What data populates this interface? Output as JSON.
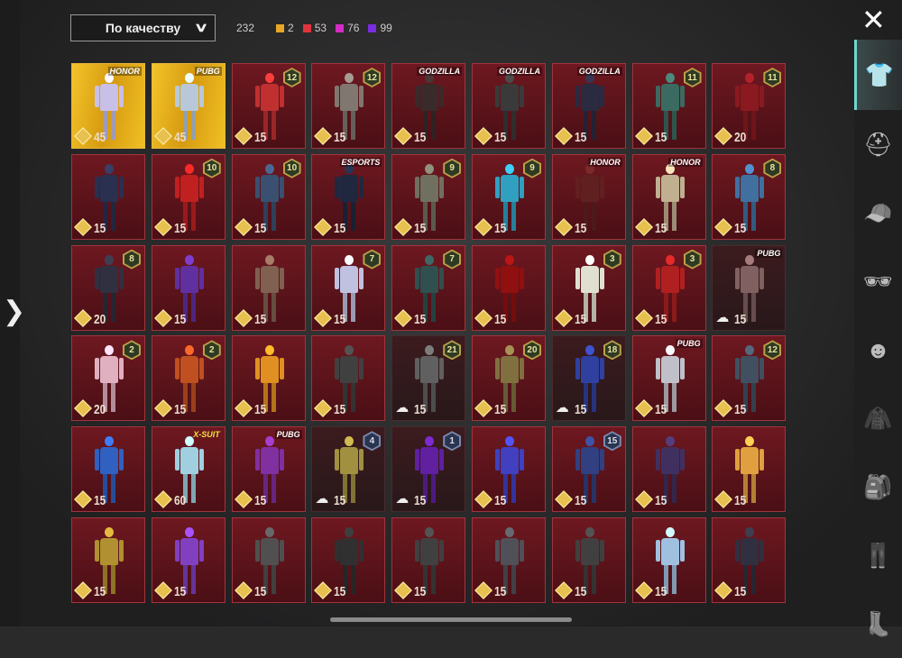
{
  "toolbar": {
    "sort_label": "По качеству",
    "total": "232",
    "quality_counts": [
      {
        "color": "#e8a628",
        "count": "2"
      },
      {
        "color": "#e0343c",
        "count": "53"
      },
      {
        "color": "#d42cc4",
        "count": "76"
      },
      {
        "color": "#7a2ce0",
        "count": "99"
      }
    ]
  },
  "sidebar": {
    "items": [
      {
        "name": "outfits",
        "icon": "👕"
      },
      {
        "name": "helmet",
        "icon": "⛑"
      },
      {
        "name": "hat",
        "icon": "🧢"
      },
      {
        "name": "glasses",
        "icon": "🕶"
      },
      {
        "name": "mask",
        "icon": "☻"
      },
      {
        "name": "jacket",
        "icon": "🧥"
      },
      {
        "name": "backpack",
        "icon": "🎒"
      },
      {
        "name": "pants",
        "icon": "👖"
      },
      {
        "name": "shoes",
        "icon": "👢"
      }
    ]
  },
  "items": [
    {
      "value": "45",
      "currency": "gold",
      "bg": "gold",
      "brand": "HONOR",
      "color": "#c8c0e8"
    },
    {
      "value": "45",
      "currency": "gold",
      "bg": "gold",
      "brand": "PUBG",
      "color": "#b8c8d8"
    },
    {
      "value": "15",
      "currency": "gold",
      "badge": "12",
      "color": "#c03030"
    },
    {
      "value": "15",
      "currency": "gold",
      "badge": "12",
      "color": "#807870"
    },
    {
      "value": "15",
      "currency": "gold",
      "brand": "GODZILLA",
      "color": "#3a2a2a"
    },
    {
      "value": "15",
      "currency": "gold",
      "brand": "GODZILLA",
      "color": "#3a3a3a"
    },
    {
      "value": "15",
      "currency": "gold",
      "brand": "GODZILLA",
      "color": "#2a2a40"
    },
    {
      "value": "15",
      "currency": "gold",
      "badge": "11",
      "color": "#3a6a60"
    },
    {
      "value": "20",
      "currency": "gold",
      "badge": "11",
      "color": "#8a1a20"
    },
    {
      "value": "15",
      "currency": "gold",
      "color": "#2a3050"
    },
    {
      "value": "15",
      "currency": "gold",
      "badge": "10",
      "color": "#c02020"
    },
    {
      "value": "15",
      "currency": "gold",
      "badge": "10",
      "color": "#3a5070"
    },
    {
      "value": "15",
      "currency": "gold",
      "brand": "ESPORTS",
      "color": "#202840"
    },
    {
      "value": "15",
      "currency": "gold",
      "badge": "9",
      "color": "#707060"
    },
    {
      "value": "15",
      "currency": "gold",
      "badge": "9",
      "color": "#30a0c0"
    },
    {
      "value": "15",
      "currency": "gold",
      "brand": "HONOR",
      "color": "#602020"
    },
    {
      "value": "15",
      "currency": "gold",
      "brand": "HONOR",
      "color": "#c0b090"
    },
    {
      "value": "15",
      "currency": "gold",
      "badge": "8",
      "color": "#4070a0"
    },
    {
      "value": "20",
      "currency": "gold",
      "badge": "8",
      "color": "#303040"
    },
    {
      "value": "15",
      "currency": "gold",
      "color": "#6030a0"
    },
    {
      "value": "15",
      "currency": "gold",
      "color": "#806050"
    },
    {
      "value": "15",
      "currency": "gold",
      "badge": "7",
      "color": "#c0c0e0"
    },
    {
      "value": "15",
      "currency": "gold",
      "badge": "7",
      "color": "#305050"
    },
    {
      "value": "15",
      "currency": "gold",
      "color": "#901010"
    },
    {
      "value": "15",
      "currency": "gold",
      "badge": "3",
      "color": "#e0e0d0"
    },
    {
      "value": "15",
      "currency": "gold",
      "badge": "3",
      "color": "#b02020"
    },
    {
      "value": "15",
      "currency": "cloud",
      "bg": "dark",
      "brand": "PUBG",
      "color": "#806060"
    },
    {
      "value": "20",
      "currency": "gold",
      "badge": "2",
      "color": "#e0b0c0"
    },
    {
      "value": "15",
      "currency": "gold",
      "badge": "2",
      "color": "#c05020"
    },
    {
      "value": "15",
      "currency": "gold",
      "color": "#e09020"
    },
    {
      "value": "15",
      "currency": "gold",
      "color": "#404040"
    },
    {
      "value": "15",
      "currency": "cloud",
      "bg": "dark",
      "badge": "21",
      "color": "#606060"
    },
    {
      "value": "15",
      "currency": "gold",
      "badge": "20",
      "color": "#807040"
    },
    {
      "value": "15",
      "currency": "cloud",
      "bg": "dark",
      "badge": "18",
      "color": "#3040a0"
    },
    {
      "value": "15",
      "currency": "gold",
      "brand": "PUBG",
      "color": "#c0c0c8"
    },
    {
      "value": "15",
      "currency": "gold",
      "badge": "12",
      "color": "#405060"
    },
    {
      "value": "15",
      "currency": "gold",
      "color": "#3060c0"
    },
    {
      "value": "60",
      "currency": "gold",
      "brand": "X-SUIT",
      "color": "#a0d0e0"
    },
    {
      "value": "15",
      "currency": "gold",
      "brand": "PUBG",
      "color": "#8030a0"
    },
    {
      "value": "15",
      "currency": "cloud",
      "bg": "dark",
      "badge": "4",
      "badge_style": "blue",
      "color": "#a09040"
    },
    {
      "value": "15",
      "currency": "cloud",
      "bg": "dark",
      "badge": "1",
      "badge_style": "blue",
      "color": "#6020a0"
    },
    {
      "value": "15",
      "currency": "gold",
      "color": "#4040c0"
    },
    {
      "value": "15",
      "currency": "gold",
      "badge": "15",
      "badge_style": "blue",
      "color": "#304080"
    },
    {
      "value": "15",
      "currency": "gold",
      "color": "#403060"
    },
    {
      "value": "15",
      "currency": "gold",
      "color": "#e0a040"
    },
    {
      "value": "15",
      "currency": "gold",
      "color": "#b09030"
    },
    {
      "value": "15",
      "currency": "gold",
      "color": "#8040c0"
    },
    {
      "value": "15",
      "currency": "gold",
      "color": "#505050"
    },
    {
      "value": "15",
      "currency": "gold",
      "color": "#303030"
    },
    {
      "value": "15",
      "currency": "gold",
      "color": "#404040"
    },
    {
      "value": "15",
      "currency": "gold",
      "color": "#505058"
    },
    {
      "value": "15",
      "currency": "gold",
      "color": "#404040"
    },
    {
      "value": "15",
      "currency": "gold",
      "color": "#a0c0e0"
    },
    {
      "value": "15",
      "currency": "gold",
      "color": "#303040"
    }
  ]
}
